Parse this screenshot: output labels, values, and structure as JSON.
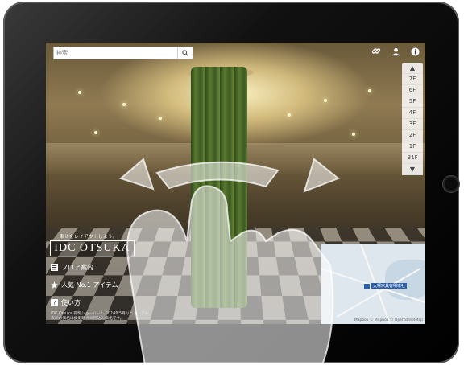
{
  "search": {
    "placeholder": "検索"
  },
  "toolbar": {
    "icons": [
      "link-icon",
      "person-icon",
      "info-icon"
    ]
  },
  "floor_nav": {
    "up_arrow": "▲",
    "floors": [
      "7F",
      "6F",
      "5F",
      "4F",
      "3F",
      "2F",
      "1F",
      "B1F"
    ],
    "down_arrow": "▼"
  },
  "brand": {
    "tagline": "幸せをレイアウトしよう。",
    "logo_text": "IDC OTSUKA"
  },
  "menu": {
    "items": [
      {
        "label": "フロア案内",
        "icon": "floor-guide-icon"
      },
      {
        "label": "人気 No.1 アイテム",
        "icon": "popular-item-icon"
      },
      {
        "label": "使い方",
        "icon": "help-icon"
      }
    ]
  },
  "footer": {
    "line1": "IDC Otsuka 有明ショールーム 2014年5月リニューアル",
    "line2": "表示の価格は撮影時点の税込み価格です。"
  },
  "map": {
    "label": "大塚家具有明本社",
    "attribution": "Mapbox © Mapbox © OpenStreetMap"
  },
  "colors": {
    "bezel": "#000000",
    "map_marker": "#2d5fa8",
    "panel_bg": "#ffffff"
  }
}
